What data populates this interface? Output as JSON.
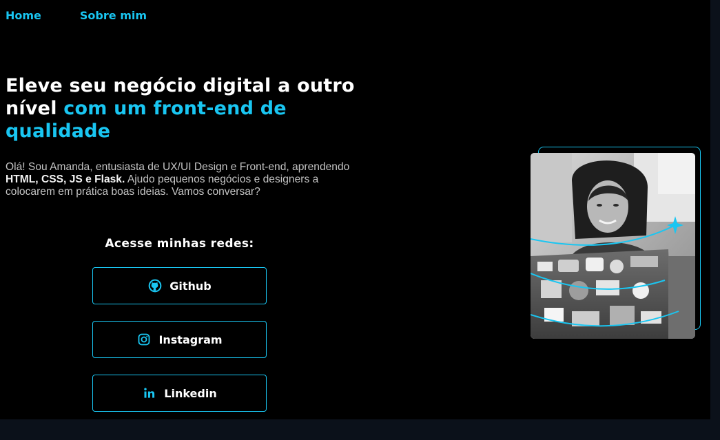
{
  "nav": {
    "items": [
      {
        "label": "Home"
      },
      {
        "label": "Sobre mim"
      }
    ]
  },
  "hero": {
    "title_plain": "Eleve seu negócio digital a outro nível",
    "title_accent": "com um front-end de qualidade",
    "desc_intro": "Olá! Sou Amanda, entusiasta de UX/UI Design e Front-end, aprendendo",
    "desc_strong": "HTML, CSS, JS e Flask.",
    "desc_rest": "Ajudo pequenos negócios e designers a colocarem em prática boas ideias. Vamos conversar?"
  },
  "social": {
    "heading": "Acesse minhas redes:",
    "buttons": [
      {
        "label": "Github",
        "icon": "github-icon"
      },
      {
        "label": "Instagram",
        "icon": "instagram-icon"
      },
      {
        "label": "Linkedin",
        "icon": "linkedin-icon"
      }
    ]
  },
  "profile_photo": {
    "description_icon": "sparkle-icon"
  },
  "colors": {
    "accent": "#19c6f2",
    "background": "#000000",
    "text": "#ffffff",
    "muted_text": "#c4c4c4"
  }
}
